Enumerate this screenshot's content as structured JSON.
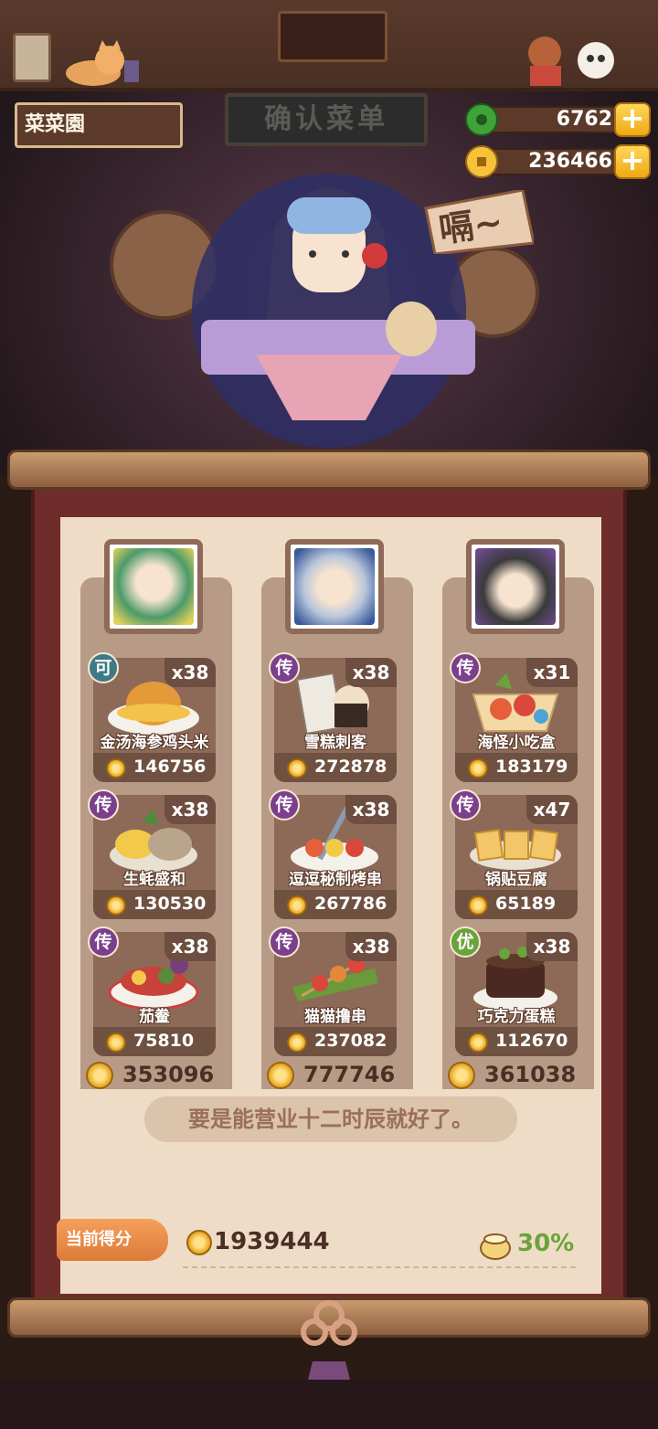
{
  "header": {
    "player_name": "菜菜園",
    "board_title": "确认菜单",
    "jade": "6762",
    "coins": "236466",
    "plus": "+",
    "speech": "嗝~"
  },
  "columns": [
    {
      "dishes": [
        {
          "rank": "可",
          "count": "x38",
          "name": "金汤海参鸡头米",
          "price": "146756"
        },
        {
          "rank": "传",
          "count": "x38",
          "name": "生蚝盛和",
          "price": "130530"
        },
        {
          "rank": "传",
          "count": "x38",
          "name": "茄鲞",
          "price": "75810"
        }
      ],
      "total": "353096"
    },
    {
      "dishes": [
        {
          "rank": "传",
          "count": "x38",
          "name": "雪糕刺客",
          "price": "272878"
        },
        {
          "rank": "传",
          "count": "x38",
          "name": "逗逗秘制烤串",
          "price": "267786"
        },
        {
          "rank": "传",
          "count": "x38",
          "name": "猫猫撸串",
          "price": "237082"
        }
      ],
      "total": "777746"
    },
    {
      "dishes": [
        {
          "rank": "传",
          "count": "x31",
          "name": "海怪小吃盒",
          "price": "183179"
        },
        {
          "rank": "传",
          "count": "x47",
          "name": "锅贴豆腐",
          "price": "65189"
        },
        {
          "rank": "优",
          "count": "x38",
          "name": "巧克力蛋糕",
          "price": "112670"
        }
      ],
      "total": "361038"
    }
  ],
  "quote": "要是能营业十二时辰就好了。",
  "score": {
    "label": "当前得分",
    "value": "1939444",
    "bonus": "30%"
  }
}
